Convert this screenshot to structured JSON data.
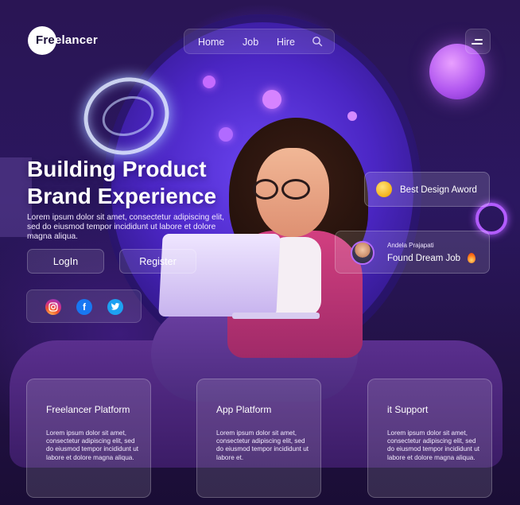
{
  "brand": {
    "logo_prefix": "Fre",
    "logo_suffix": "elancer"
  },
  "nav": {
    "links": [
      "Home",
      "Job",
      "Hire"
    ],
    "search_icon": "search-icon",
    "menu_icon": "hamburger-menu-icon"
  },
  "hero": {
    "title_line1": "Building Product",
    "title_line2": "Brand Experience",
    "description": "Lorem ipsum dolor sit amet, consectetur adipiscing elit, sed do eiusmod tempor incididunt ut labore et dolore magna aliqua.",
    "login_label": "LogIn",
    "register_label": "Register"
  },
  "social": {
    "icons": [
      "instagram-icon",
      "facebook-icon",
      "twitter-icon"
    ]
  },
  "award_card": {
    "label": "Best Design Aword",
    "icon": "medal-icon"
  },
  "user_card": {
    "name": "Andela Prajapati",
    "status": "Found Dream Job",
    "icon": "fire-icon"
  },
  "features": [
    {
      "title": "Freelancer Platform",
      "text": "Lorem ipsum dolor sit amet, consectetur adipiscing elit, sed do eiusmod tempor incididunt ut labore et dolore magna aliqua."
    },
    {
      "title": "App Platform",
      "text": "Lorem ipsum dolor sit amet, consectetur adipiscing elit, sed do eiusmod tempor incididunt ut labore et."
    },
    {
      "title": "it Support",
      "text": "Lorem ipsum dolor sit amet, consectetur adipiscing elit, sed do eiusmod tempor incididunt ut labore et dolore magna aliqua."
    }
  ],
  "colors": {
    "background": "#2a1554",
    "accent_purple": "#6a3ae8",
    "ring_glow": "#b35cff",
    "jacket_pink": "#d23f80"
  }
}
